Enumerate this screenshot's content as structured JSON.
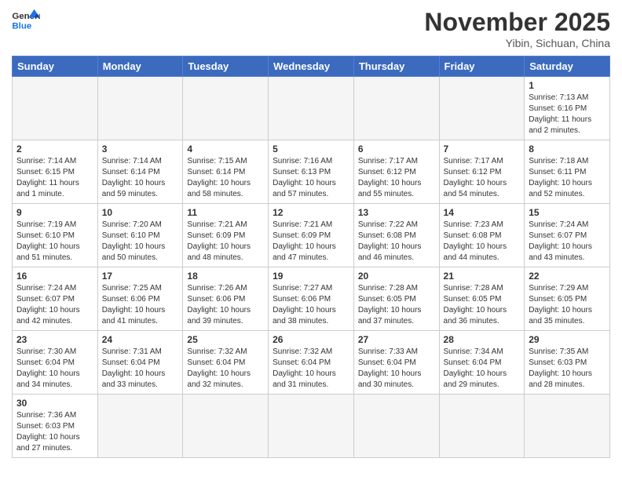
{
  "header": {
    "logo_general": "General",
    "logo_blue": "Blue",
    "month_title": "November 2025",
    "location": "Yibin, Sichuan, China"
  },
  "days_of_week": [
    "Sunday",
    "Monday",
    "Tuesday",
    "Wednesday",
    "Thursday",
    "Friday",
    "Saturday"
  ],
  "weeks": [
    [
      {
        "day": "",
        "info": ""
      },
      {
        "day": "",
        "info": ""
      },
      {
        "day": "",
        "info": ""
      },
      {
        "day": "",
        "info": ""
      },
      {
        "day": "",
        "info": ""
      },
      {
        "day": "",
        "info": ""
      },
      {
        "day": "1",
        "info": "Sunrise: 7:13 AM\nSunset: 6:16 PM\nDaylight: 11 hours\nand 2 minutes."
      }
    ],
    [
      {
        "day": "2",
        "info": "Sunrise: 7:14 AM\nSunset: 6:15 PM\nDaylight: 11 hours\nand 1 minute."
      },
      {
        "day": "3",
        "info": "Sunrise: 7:14 AM\nSunset: 6:14 PM\nDaylight: 10 hours\nand 59 minutes."
      },
      {
        "day": "4",
        "info": "Sunrise: 7:15 AM\nSunset: 6:14 PM\nDaylight: 10 hours\nand 58 minutes."
      },
      {
        "day": "5",
        "info": "Sunrise: 7:16 AM\nSunset: 6:13 PM\nDaylight: 10 hours\nand 57 minutes."
      },
      {
        "day": "6",
        "info": "Sunrise: 7:17 AM\nSunset: 6:12 PM\nDaylight: 10 hours\nand 55 minutes."
      },
      {
        "day": "7",
        "info": "Sunrise: 7:17 AM\nSunset: 6:12 PM\nDaylight: 10 hours\nand 54 minutes."
      },
      {
        "day": "8",
        "info": "Sunrise: 7:18 AM\nSunset: 6:11 PM\nDaylight: 10 hours\nand 52 minutes."
      }
    ],
    [
      {
        "day": "9",
        "info": "Sunrise: 7:19 AM\nSunset: 6:10 PM\nDaylight: 10 hours\nand 51 minutes."
      },
      {
        "day": "10",
        "info": "Sunrise: 7:20 AM\nSunset: 6:10 PM\nDaylight: 10 hours\nand 50 minutes."
      },
      {
        "day": "11",
        "info": "Sunrise: 7:21 AM\nSunset: 6:09 PM\nDaylight: 10 hours\nand 48 minutes."
      },
      {
        "day": "12",
        "info": "Sunrise: 7:21 AM\nSunset: 6:09 PM\nDaylight: 10 hours\nand 47 minutes."
      },
      {
        "day": "13",
        "info": "Sunrise: 7:22 AM\nSunset: 6:08 PM\nDaylight: 10 hours\nand 46 minutes."
      },
      {
        "day": "14",
        "info": "Sunrise: 7:23 AM\nSunset: 6:08 PM\nDaylight: 10 hours\nand 44 minutes."
      },
      {
        "day": "15",
        "info": "Sunrise: 7:24 AM\nSunset: 6:07 PM\nDaylight: 10 hours\nand 43 minutes."
      }
    ],
    [
      {
        "day": "16",
        "info": "Sunrise: 7:24 AM\nSunset: 6:07 PM\nDaylight: 10 hours\nand 42 minutes."
      },
      {
        "day": "17",
        "info": "Sunrise: 7:25 AM\nSunset: 6:06 PM\nDaylight: 10 hours\nand 41 minutes."
      },
      {
        "day": "18",
        "info": "Sunrise: 7:26 AM\nSunset: 6:06 PM\nDaylight: 10 hours\nand 39 minutes."
      },
      {
        "day": "19",
        "info": "Sunrise: 7:27 AM\nSunset: 6:06 PM\nDaylight: 10 hours\nand 38 minutes."
      },
      {
        "day": "20",
        "info": "Sunrise: 7:28 AM\nSunset: 6:05 PM\nDaylight: 10 hours\nand 37 minutes."
      },
      {
        "day": "21",
        "info": "Sunrise: 7:28 AM\nSunset: 6:05 PM\nDaylight: 10 hours\nand 36 minutes."
      },
      {
        "day": "22",
        "info": "Sunrise: 7:29 AM\nSunset: 6:05 PM\nDaylight: 10 hours\nand 35 minutes."
      }
    ],
    [
      {
        "day": "23",
        "info": "Sunrise: 7:30 AM\nSunset: 6:04 PM\nDaylight: 10 hours\nand 34 minutes."
      },
      {
        "day": "24",
        "info": "Sunrise: 7:31 AM\nSunset: 6:04 PM\nDaylight: 10 hours\nand 33 minutes."
      },
      {
        "day": "25",
        "info": "Sunrise: 7:32 AM\nSunset: 6:04 PM\nDaylight: 10 hours\nand 32 minutes."
      },
      {
        "day": "26",
        "info": "Sunrise: 7:32 AM\nSunset: 6:04 PM\nDaylight: 10 hours\nand 31 minutes."
      },
      {
        "day": "27",
        "info": "Sunrise: 7:33 AM\nSunset: 6:04 PM\nDaylight: 10 hours\nand 30 minutes."
      },
      {
        "day": "28",
        "info": "Sunrise: 7:34 AM\nSunset: 6:04 PM\nDaylight: 10 hours\nand 29 minutes."
      },
      {
        "day": "29",
        "info": "Sunrise: 7:35 AM\nSunset: 6:03 PM\nDaylight: 10 hours\nand 28 minutes."
      }
    ],
    [
      {
        "day": "30",
        "info": "Sunrise: 7:36 AM\nSunset: 6:03 PM\nDaylight: 10 hours\nand 27 minutes."
      },
      {
        "day": "",
        "info": ""
      },
      {
        "day": "",
        "info": ""
      },
      {
        "day": "",
        "info": ""
      },
      {
        "day": "",
        "info": ""
      },
      {
        "day": "",
        "info": ""
      },
      {
        "day": "",
        "info": ""
      }
    ]
  ]
}
